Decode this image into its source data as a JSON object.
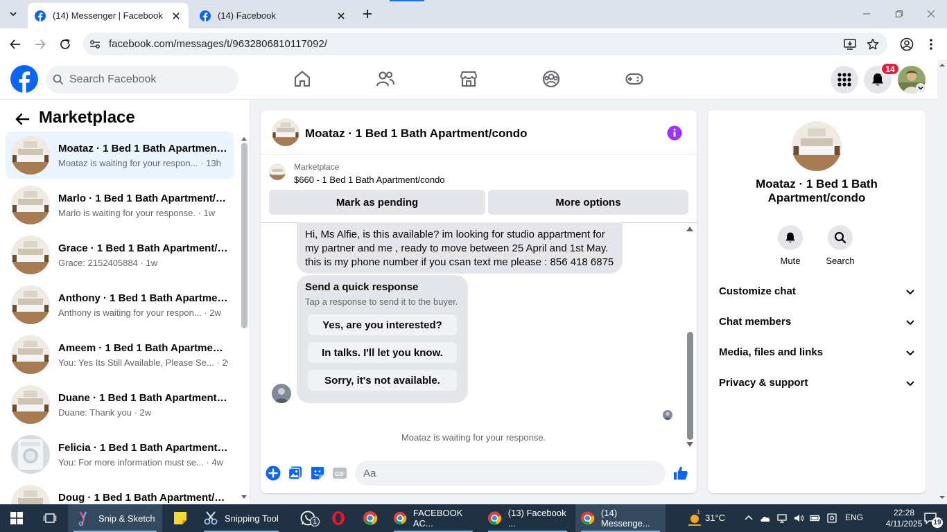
{
  "browser": {
    "tabs": [
      {
        "title": "(14) Messenger | Facebook",
        "active": true
      },
      {
        "title": "(14) Facebook",
        "active": false
      }
    ],
    "url": "facebook.com/messages/t/9632806810117092/"
  },
  "fb": {
    "search_placeholder": "Search Facebook",
    "notifications_count": "14"
  },
  "sidebar": {
    "title": "Marketplace",
    "conversations": [
      {
        "title": "Moataz · 1 Bed 1 Bath Apartment/condo",
        "preview": "Moataz is waiting for your respon... · 13h"
      },
      {
        "title": "Marlo · 1 Bed 1 Bath Apartment/condo",
        "preview": "Marlo is waiting for your response. · 1w"
      },
      {
        "title": "Grace · 1 Bed 1 Bath Apartment/condo",
        "preview": "Grace: 2152405884 · 1w"
      },
      {
        "title": "Anthony · 1 Bed 1 Bath Apartment/condo",
        "preview": "Anthony is waiting for your respon... · 2w"
      },
      {
        "title": "Ameem · 1 Bed 1 Bath Apartment/condo",
        "preview": "You: Yes Its Still Available, Please Se... · 2w"
      },
      {
        "title": "Duane · 1 Bed 1 Bath Apartment/condo",
        "preview": "Duane: Thank you · 2w"
      },
      {
        "title": "Felicia · 1 Bed 1 Bath Apartment/condo",
        "preview": "You: For more information must se... · 4w"
      },
      {
        "title": "Doug · 1 Bed 1 Bath Apartment/condo",
        "preview": ""
      }
    ]
  },
  "chat": {
    "title": "Moataz · 1 Bed 1 Bath Apartment/condo",
    "marketplace_label": "Marketplace",
    "listing": "$660 - 1 Bed 1 Bath Apartment/condo",
    "mark_pending": "Mark as pending",
    "more_options": "More options",
    "message_lines": [
      "Hi, Ms Alfie, is this available? im looking for studio appartment for",
      "my partner and me , ready to move between 25 April and 1st May.",
      "this is my phone number if you csan text me please : 856 418 6875"
    ],
    "quick_response": {
      "title": "Send a quick response",
      "subtitle": "Tap a response to send it to the buyer.",
      "options": [
        "Yes, are you interested?",
        "In talks. I'll let you know.",
        "Sorry, it's not available."
      ]
    },
    "waiting_text": "Moataz is waiting for your response.",
    "composer_placeholder": "Aa"
  },
  "details": {
    "title": "Moataz · 1 Bed 1 Bath Apartment/condo",
    "actions": [
      {
        "label": "Mute"
      },
      {
        "label": "Search"
      }
    ],
    "sections": [
      "Customize chat",
      "Chat members",
      "Media, files and links",
      "Privacy & support"
    ]
  },
  "taskbar": {
    "apps": [
      {
        "label": "Snip & Sketch"
      },
      {
        "label": "Snipping Tool"
      },
      {
        "label": "FACEBOOK AC..."
      },
      {
        "label": "(13) Facebook ..."
      },
      {
        "label": "(14) Messenge..."
      }
    ],
    "whatsapp_badge": "1",
    "weather_alert": "1",
    "temperature": "31°C",
    "language": "ENG",
    "time": "22:28",
    "date": "4/11/2025",
    "notification_count": "19"
  },
  "colors": {
    "fb_blue": "#0866ff",
    "accent_purple": "#a033ff",
    "badge_red": "#e41e3f",
    "taskbar": "#1f3142"
  }
}
